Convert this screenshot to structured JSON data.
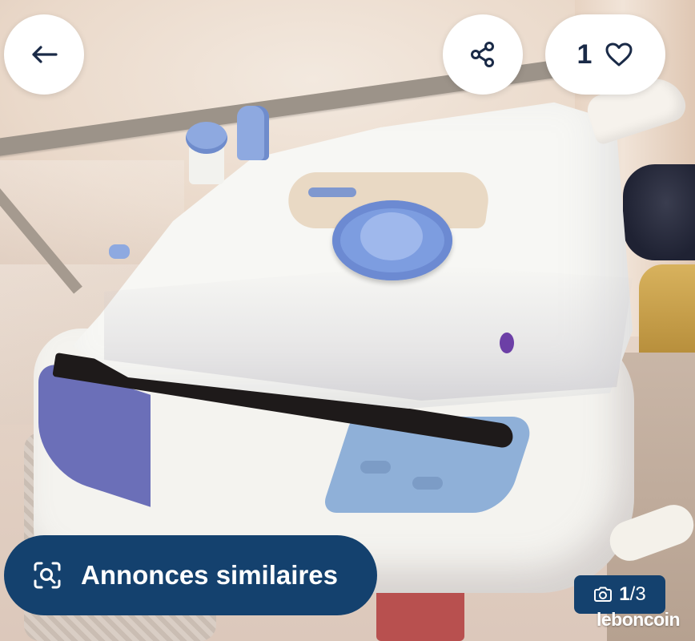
{
  "photo": {
    "subject": "steam generator iron"
  },
  "top_bar": {
    "back_icon": "arrow-left-icon",
    "share_icon": "share-icon",
    "like_icon": "heart-outline-icon",
    "like_count": "1"
  },
  "similar": {
    "icon": "visual-search-icon",
    "label": "Annonces similaires"
  },
  "counter": {
    "icon": "camera-icon",
    "current": "1",
    "separator": "/",
    "total": "3"
  },
  "watermark": {
    "text": "leboncoin"
  },
  "colors": {
    "primary_dark_blue": "#14416e",
    "button_white": "#ffffff",
    "icon_dark": "#1a2a47"
  }
}
